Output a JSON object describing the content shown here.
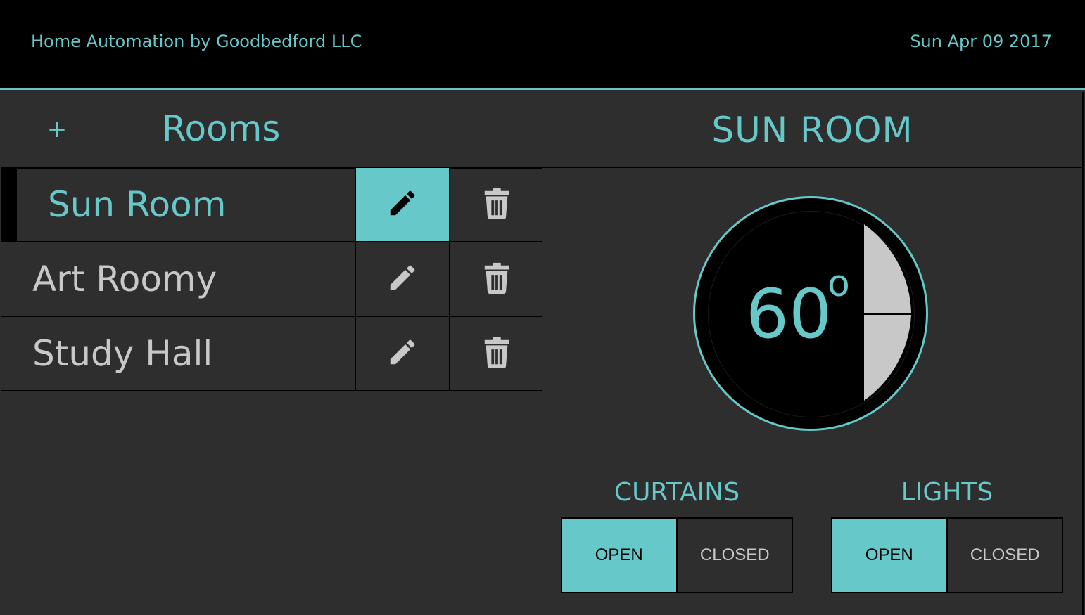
{
  "header": {
    "app_title": "Home Automation by Goodbedford LLC",
    "date": "Sun Apr 09 2017"
  },
  "rooms_panel": {
    "add_label": "+",
    "title": "Rooms",
    "rooms": [
      {
        "name": "Sun Room",
        "active": true
      },
      {
        "name": "Art Roomy",
        "active": false
      },
      {
        "name": "Study Hall",
        "active": false
      }
    ],
    "icons": {
      "edit": "pencil-icon",
      "delete": "trash-icon"
    }
  },
  "room_detail": {
    "title": "SUN ROOM",
    "thermostat": {
      "temperature": "60",
      "degree_symbol": "o",
      "increase_label": "+",
      "decrease_label": "-"
    },
    "curtains": {
      "label": "CURTAINS",
      "open_label": "OPEN",
      "closed_label": "CLOSED",
      "state": "open"
    },
    "lights": {
      "label": "LIGHTS",
      "open_label": "OPEN",
      "closed_label": "CLOSED",
      "state": "open"
    }
  },
  "colors": {
    "accent": "#66c8c8",
    "background": "#2e2e2e",
    "header_bg": "#000000",
    "inactive_text": "#c8c8c8"
  }
}
